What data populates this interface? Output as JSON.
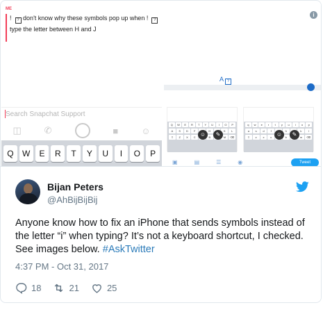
{
  "tweet": {
    "name": "Bijan Peters",
    "handle": "@AhBijBijBij",
    "text": "Anyone know how to fix an iPhone that sends symbols instead of the letter “i” when typing? It’s not a keyboard shortcut, I checked. See images below. ",
    "hashtag": "#AskTwitter",
    "timestamp": "4:37 PM - Oct 31, 2017",
    "replies": "18",
    "retweets": "21",
    "likes": "25"
  },
  "screenshot_left": {
    "sender_label": "ME",
    "message_part1": "don't know why these symbols pop up when",
    "message_part2": "type the letter between H and J",
    "input_placeholder": "Search Snapchat Support",
    "keyboard_keys": [
      "Q",
      "W",
      "E",
      "R",
      "T",
      "Y",
      "U",
      "I",
      "O",
      "P"
    ]
  },
  "screenshot_right": {
    "suggestion_letter": "A",
    "tweet_button": "Tweet"
  },
  "colors": {
    "twitter_blue": "#1da1f2",
    "snapchat_accent": "#f23c57",
    "hashtag_blue": "#2b7bb9",
    "meta_grey": "#657786"
  }
}
